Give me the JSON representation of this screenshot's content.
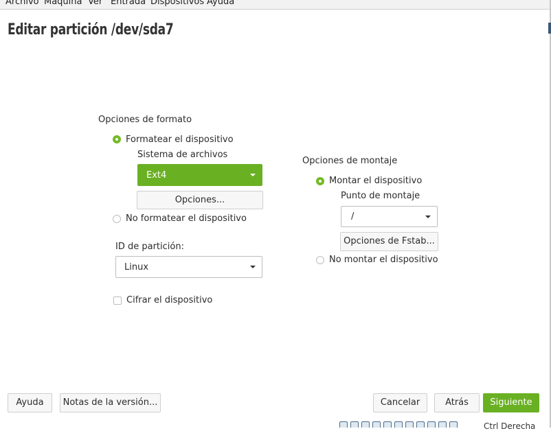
{
  "menubar": {
    "items": [
      "Archivo",
      "Máquina",
      "Ver",
      "Entrada",
      "Dispositivos",
      "Ayuda"
    ]
  },
  "page": {
    "title": "Editar partición /dev/sda7"
  },
  "format_options": {
    "heading": "Opciones de formato",
    "format_radio": "Formatear el dispositivo",
    "filesystem_label": "Sistema de archivos",
    "filesystem_value": "Ext4",
    "options_button": "Opciones...",
    "no_format_radio": "No formatear el dispositivo",
    "partition_id_label": "ID de partición:",
    "partition_id_value": "Linux",
    "encrypt_checkbox": "Cifrar el dispositivo"
  },
  "mount_options": {
    "heading": "Opciones de montaje",
    "mount_radio": "Montar el dispositivo",
    "mount_point_label": "Punto de montaje",
    "mount_point_value": "/",
    "fstab_button": "Opciones de Fstab...",
    "no_mount_radio": "No montar el dispositivo"
  },
  "footer": {
    "help": "Ayuda",
    "release_notes": "Notas de la versión...",
    "cancel": "Cancelar",
    "back": "Atrás",
    "next": "Siguiente"
  },
  "statusbar": {
    "host_key": "Ctrl Derecha"
  },
  "colors": {
    "accent": "#6ab023"
  }
}
